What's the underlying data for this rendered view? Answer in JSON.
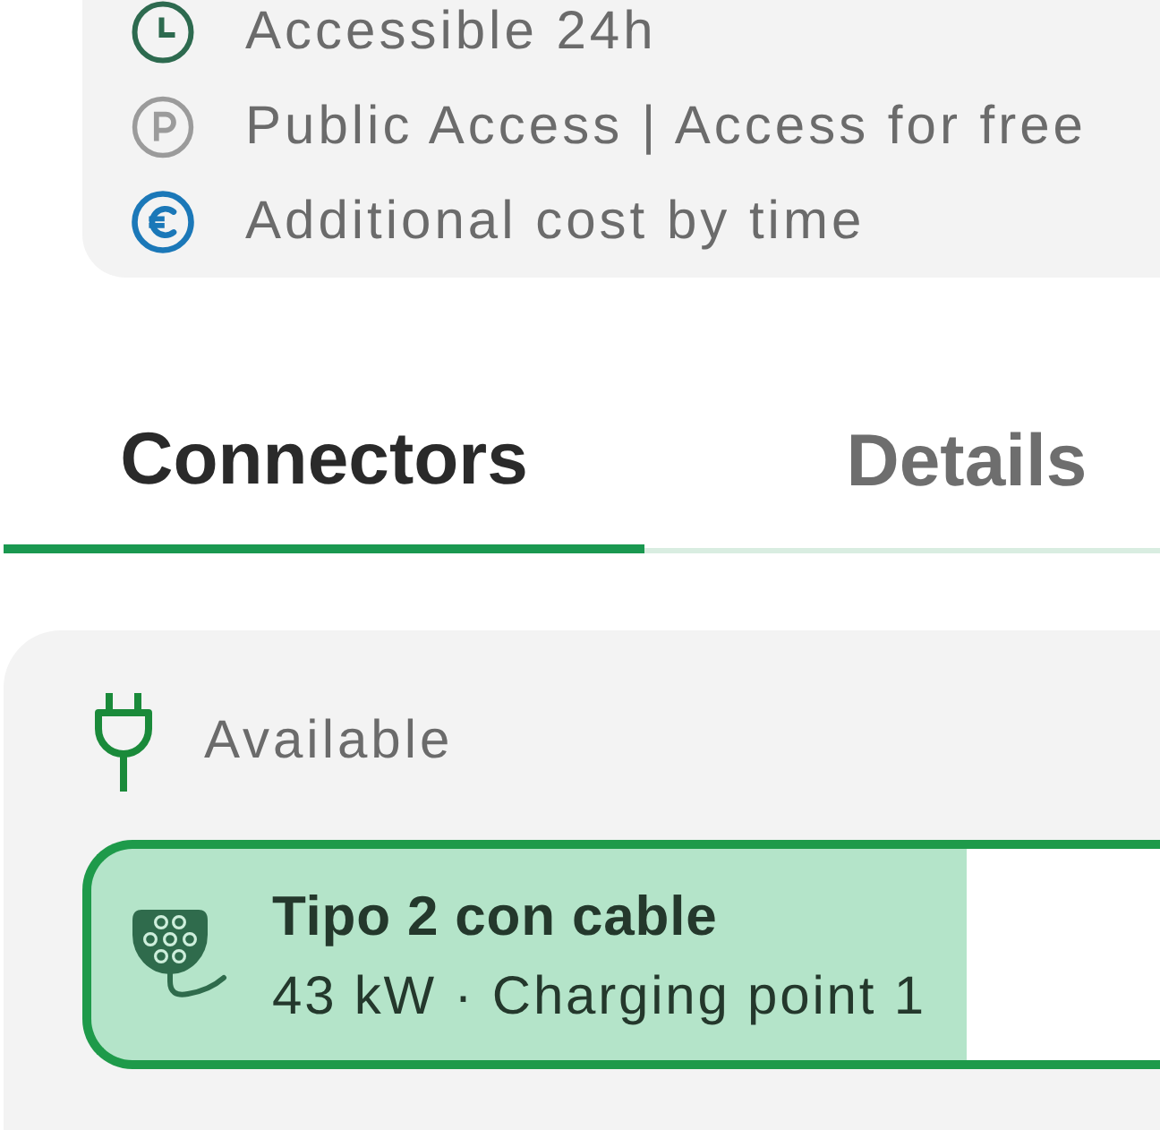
{
  "info_card": {
    "items": [
      {
        "kind": "hours",
        "text": "Accessible 24h"
      },
      {
        "kind": "access",
        "text": "Public Access | Access for free"
      },
      {
        "kind": "cost",
        "text": "Additional cost by time"
      }
    ]
  },
  "tabs": [
    {
      "label": "Connectors",
      "selected": true
    },
    {
      "label": "Details",
      "selected": false
    }
  ],
  "connectors": {
    "status": "Available",
    "items": [
      {
        "title": "Tipo 2 con cable",
        "subtitle": "43 kW · Charging point 1",
        "selected": true
      }
    ]
  }
}
